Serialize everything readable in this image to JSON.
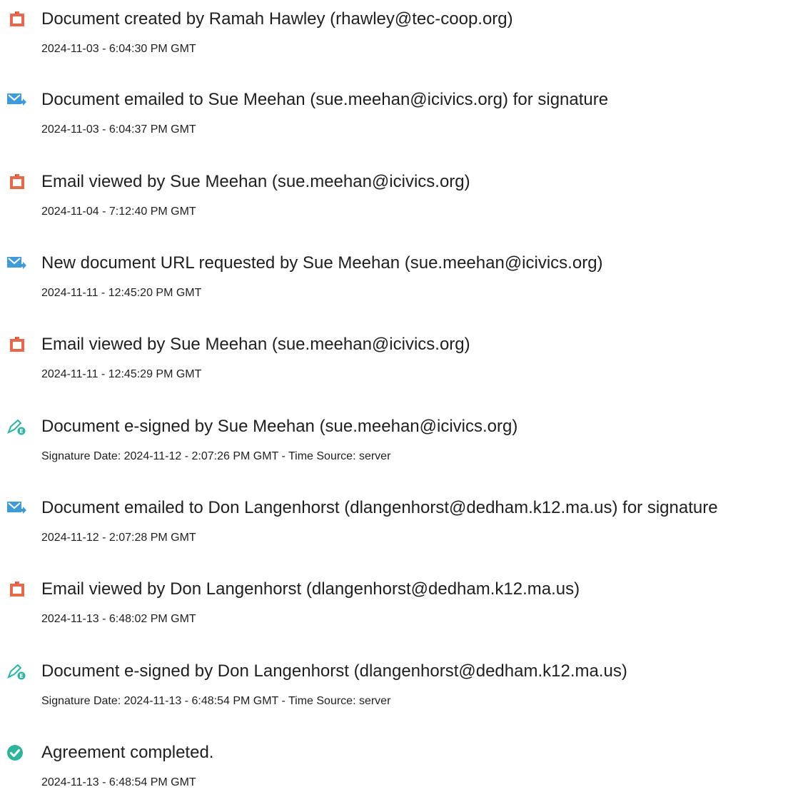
{
  "events": [
    {
      "icon": "document-created-icon",
      "title": "Document created by Ramah Hawley (rhawley@tec-coop.org)",
      "date": "2024-11-03 - 6:04:30 PM GMT"
    },
    {
      "icon": "email-sent-icon",
      "title": "Document emailed to Sue Meehan (sue.meehan@icivics.org) for signature",
      "date": "2024-11-03 - 6:04:37 PM GMT"
    },
    {
      "icon": "document-viewed-icon",
      "title": "Email viewed by Sue Meehan (sue.meehan@icivics.org)",
      "date": "2024-11-04 - 7:12:40 PM GMT"
    },
    {
      "icon": "email-sent-icon",
      "title": "New document URL requested by Sue Meehan (sue.meehan@icivics.org)",
      "date": "2024-11-11 - 12:45:20 PM GMT"
    },
    {
      "icon": "document-viewed-icon",
      "title": "Email viewed by Sue Meehan (sue.meehan@icivics.org)",
      "date": "2024-11-11 - 12:45:29 PM GMT"
    },
    {
      "icon": "e-sign-pen-icon",
      "title": "Document e-signed by Sue Meehan (sue.meehan@icivics.org)",
      "date": "Signature Date: 2024-11-12 - 2:07:26 PM GMT - Time Source: server"
    },
    {
      "icon": "email-sent-icon",
      "title": "Document emailed to Don Langenhorst (dlangenhorst@dedham.k12.ma.us) for signature",
      "date": "2024-11-12 - 2:07:28 PM GMT"
    },
    {
      "icon": "document-viewed-icon",
      "title": "Email viewed by Don Langenhorst (dlangenhorst@dedham.k12.ma.us)",
      "date": "2024-11-13 - 6:48:02 PM GMT"
    },
    {
      "icon": "e-sign-pen-icon",
      "title": "Document e-signed by Don Langenhorst (dlangenhorst@dedham.k12.ma.us)",
      "date": "Signature Date: 2024-11-13 - 6:48:54 PM GMT - Time Source: server"
    },
    {
      "icon": "agreement-completed-icon",
      "title": "Agreement completed.",
      "date": "2024-11-13 - 6:48:54 PM GMT"
    }
  ],
  "colors": {
    "document_icon": "#e8674a",
    "email_icon": "#3d9bd8",
    "sign_icon": "#2bb5a4",
    "complete_icon": "#2db59a"
  }
}
